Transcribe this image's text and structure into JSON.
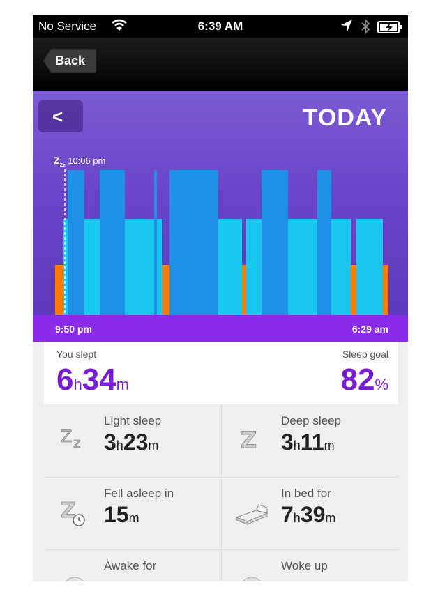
{
  "status": {
    "carrier": "No Service",
    "time": "6:39 AM"
  },
  "nav": {
    "back_label": "Back"
  },
  "hero": {
    "title": "TODAY",
    "zz_label": "10:06 pm",
    "start": "9:50 pm",
    "end": "6:29 am"
  },
  "summary": {
    "slept_label": "You slept",
    "slept_h": "6",
    "slept_m": "34",
    "goal_label": "Sleep goal",
    "goal_value": "82"
  },
  "cells": [
    {
      "title": "Light sleep",
      "h": "3",
      "m": "23"
    },
    {
      "title": "Deep sleep",
      "h": "3",
      "m": "11"
    },
    {
      "title": "Fell asleep in",
      "m": "15"
    },
    {
      "title": "In bed for",
      "h": "7",
      "m": "39"
    },
    {
      "title": "Awake for"
    },
    {
      "title": "Woke up"
    }
  ],
  "units": {
    "h": "h",
    "m": "m",
    "pct": "%"
  },
  "colors": {
    "deep": "#1e90e6",
    "light": "#17c7f0",
    "awake": "#ff7a00",
    "accent": "#7a1bd8"
  },
  "chart_data": {
    "type": "bar",
    "series": [
      {
        "name": "awake",
        "color": "#ff7a00"
      },
      {
        "name": "light",
        "color": "#17c7f0"
      },
      {
        "name": "deep",
        "color": "#1e90e6"
      }
    ]
  }
}
